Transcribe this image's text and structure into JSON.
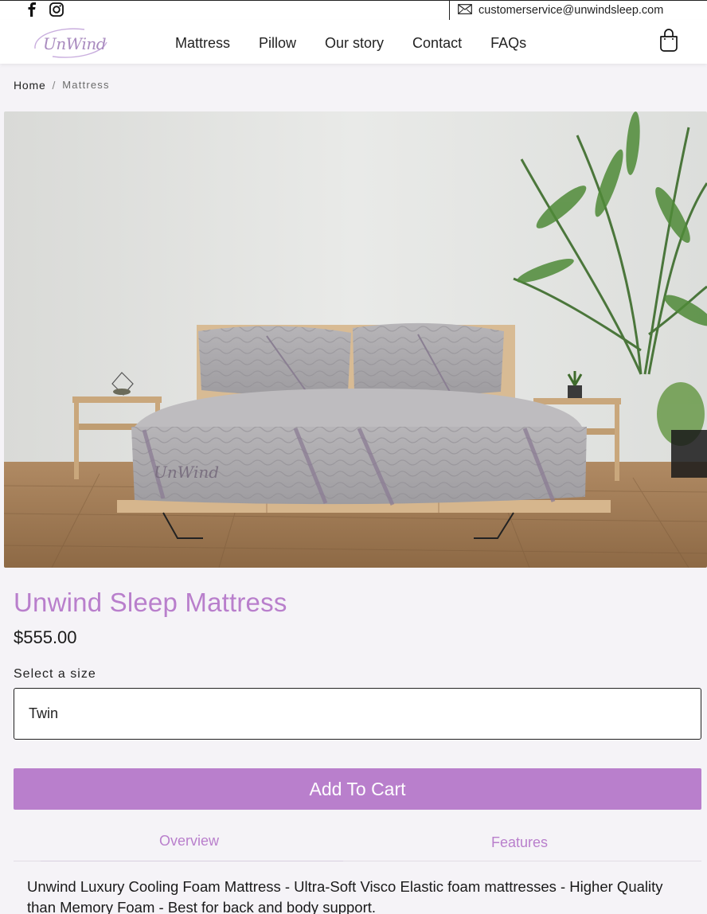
{
  "topbar": {
    "email": "customerservice@unwindsleep.com"
  },
  "brand": {
    "logo_text": "UnWind",
    "accent": "#b97fcc"
  },
  "nav": {
    "items": [
      {
        "label": "Mattress"
      },
      {
        "label": "Pillow"
      },
      {
        "label": "Our story"
      },
      {
        "label": "Contact"
      },
      {
        "label": "FAQs"
      }
    ]
  },
  "breadcrumb": {
    "home": "Home",
    "separator": "/",
    "current": "Mattress"
  },
  "hero": {
    "bed_logo": "UnWind"
  },
  "product": {
    "title": "Unwind Sleep Mattress",
    "price": "$555.00",
    "size_label": "Select a size",
    "size_value": "Twin",
    "add_to_cart": "Add To Cart"
  },
  "tabs": {
    "overview": "Overview",
    "features": "Features"
  },
  "description": "Unwind Luxury Cooling Foam Mattress - Ultra-Soft Visco Elastic foam mattresses - Higher Quality than Memory Foam - Best for back and body support."
}
